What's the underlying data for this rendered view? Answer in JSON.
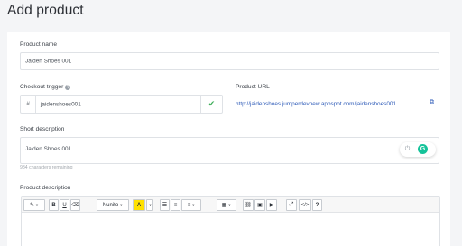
{
  "page": {
    "title": "Add product"
  },
  "product_name": {
    "label": "Product name",
    "value": "Jaiden Shoes 001"
  },
  "checkout_trigger": {
    "label": "Checkout trigger",
    "help_icon": "question-icon",
    "prefix": "#",
    "value": "jaidenshoes001",
    "status_icon": "check-icon",
    "status_color": "#3fae5a"
  },
  "product_url": {
    "label": "Product URL",
    "link": "http://jaidenshoes.jumperdevnew.appspot.com/jaidenshoes001",
    "link_color": "#2e5bb8",
    "icon": "external-link-icon"
  },
  "short_description": {
    "label": "Short description",
    "value": "Jaiden Shoes 001",
    "remaining": "984 characters remaining",
    "grammarly_letter": "G",
    "grammarly_color": "#15c39a"
  },
  "product_description": {
    "label": "Product description",
    "toolbar": {
      "font_name": "Nunito",
      "bold": "B",
      "underline": "U",
      "font_color": "A",
      "help": "?"
    }
  }
}
